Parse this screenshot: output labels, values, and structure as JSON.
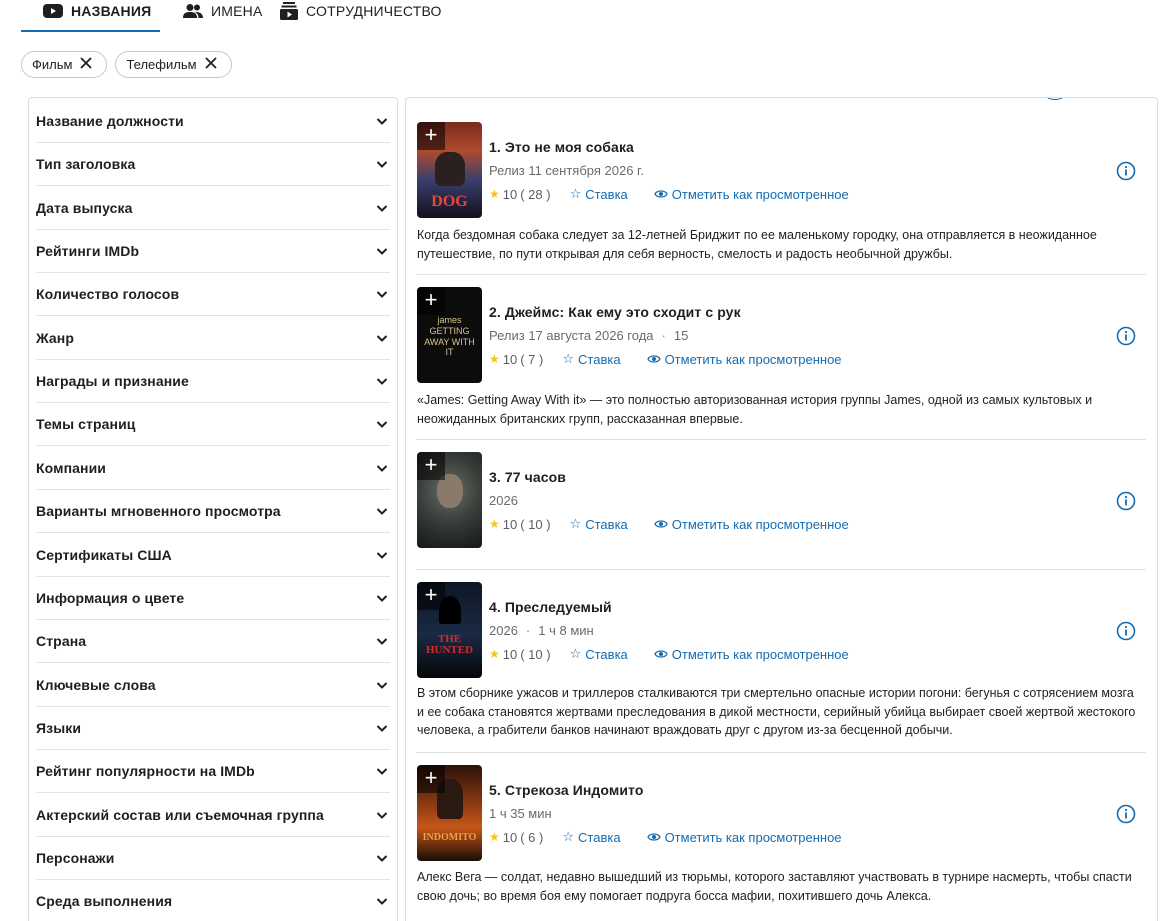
{
  "tabs": [
    {
      "label": "НАЗВАНИЯ",
      "icon": "play-box-icon",
      "active": true
    },
    {
      "label": "ИМЕНА",
      "icon": "people-icon",
      "active": false
    },
    {
      "label": "СОТРУДНИЧЕСТВО",
      "icon": "collaboration-icon",
      "active": false
    }
  ],
  "chips": [
    {
      "label": "Фильм"
    },
    {
      "label": "Телефильм"
    }
  ],
  "filters": [
    "Название должности",
    "Тип заголовка",
    "Дата выпуска",
    "Рейтинги IMDb",
    "Количество голосов",
    "Жанр",
    "Награды и признание",
    "Темы страниц",
    "Компании",
    "Варианты мгновенного просмотра",
    "Сертификаты США",
    "Информация о цвете",
    "Страна",
    "Ключевые слова",
    "Языки",
    "Рейтинг популярности на IMDb",
    "Актерский состав или съемочная группа",
    "Персонажи",
    "Среда выполнения"
  ],
  "labels": {
    "rate": "Ставка",
    "mark_watched": "Отметить как просмотренное",
    "add": "+"
  },
  "colors": {
    "accent": "#136cb2",
    "star": "#f5c518"
  },
  "results": [
    {
      "title": "1. Это не моя собака",
      "meta": [
        "Релиз 11 сентября 2026 г."
      ],
      "rating": "10",
      "votes": "( 28 )",
      "description": "Когда бездомная собака следует за 12-летней Бриджит по ее маленькому городку, она отправляется в неожиданное путешествие, по пути открывая для себя верность, смелость и радость необычной дружбы.",
      "poster_text": "DOG"
    },
    {
      "title": "2. Джеймс: Как ему это сходит с рук",
      "meta": [
        "Релиз 17 августа 2026 года",
        "15"
      ],
      "rating": "10",
      "votes": "( 7 )",
      "description": "«James: Getting Away With it» — это полностью авторизованная история группы James, одной из самых культовых и неожиданных британских групп, рассказанная впервые.",
      "poster_text": "james GETTING AWAY WITH IT"
    },
    {
      "title": "3. 77 часов",
      "meta": [
        "2026"
      ],
      "rating": "10",
      "votes": "( 10 )",
      "description": "",
      "poster_text": ""
    },
    {
      "title": "4. Преследуемый",
      "meta": [
        "2026",
        "1 ч 8 мин"
      ],
      "rating": "10",
      "votes": "( 10 )",
      "description": "В этом сборнике ужасов и триллеров сталкиваются три смертельно опасные истории погони: бегунья с сотрясением мозга и ее собака становятся жертвами преследования в дикой местности, серийный убийца выбирает своей жертвой жестокого человека, а грабители банков начинают враждовать друг с другом из-за бесценной добычи.",
      "poster_text": "THE HUNTED"
    },
    {
      "title": "5. Стрекоза Индомито",
      "meta": [
        "1 ч 35 мин"
      ],
      "rating": "10",
      "votes": "( 6 )",
      "description": "Алекс Вега — солдат, недавно вышедший из тюрьмы, которого заставляют участвовать в турнире насмерть, чтобы спасти свою дочь; во время боя ему помогает подруга босса мафии, похитившего дочь Алекса.",
      "poster_text": "INDOMITO"
    }
  ]
}
